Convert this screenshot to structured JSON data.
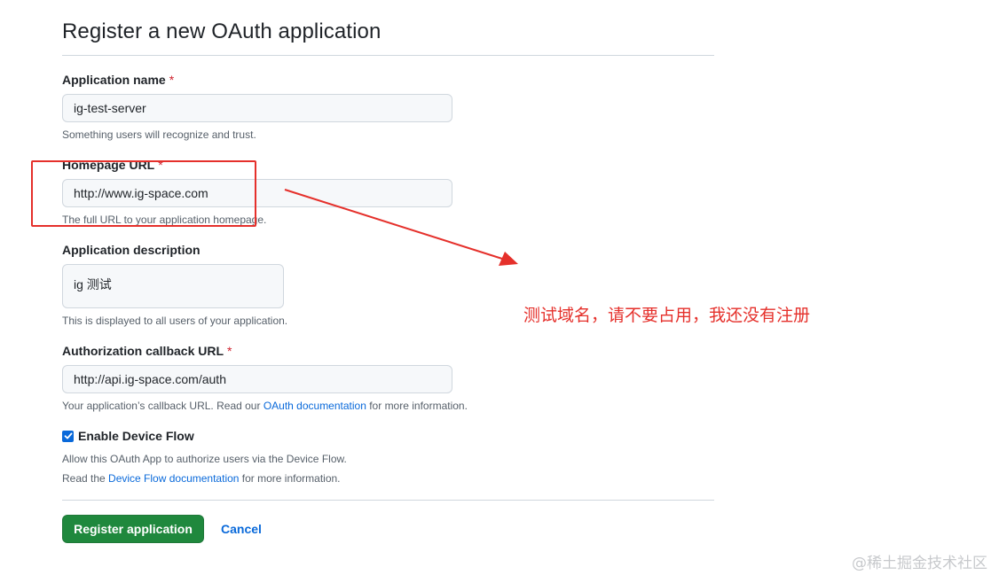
{
  "page": {
    "title": "Register a new OAuth application"
  },
  "form": {
    "app_name": {
      "label": "Application name",
      "required": "*",
      "value": "ig-test-server",
      "note": "Something users will recognize and trust."
    },
    "homepage_url": {
      "label": "Homepage URL",
      "required": "*",
      "value": "http://www.ig-space.com",
      "note": "The full URL to your application homepage."
    },
    "description": {
      "label": "Application description",
      "value": "ig 测试",
      "note": "This is displayed to all users of your application."
    },
    "callback_url": {
      "label": "Authorization callback URL",
      "required": "*",
      "value": "http://api.ig-space.com/auth",
      "note_before": "Your application’s callback URL. Read our ",
      "note_link": "OAuth documentation",
      "note_after": " for more information."
    },
    "device_flow": {
      "label": "Enable Device Flow",
      "checked": true,
      "note_line1": "Allow this OAuth App to authorize users via the Device Flow.",
      "note_line2_before": "Read the ",
      "note_line2_link": "Device Flow documentation",
      "note_line2_after": " for more information."
    }
  },
  "actions": {
    "register_label": "Register application",
    "cancel_label": "Cancel"
  },
  "annotation": {
    "text": "测试域名，请不要占用，我还没有注册",
    "color": "#e5302b"
  },
  "watermark": "@稀土掘金技术社区",
  "colors": {
    "primary_button": "#1f883d",
    "link": "#0969da",
    "required": "#cf222e"
  }
}
